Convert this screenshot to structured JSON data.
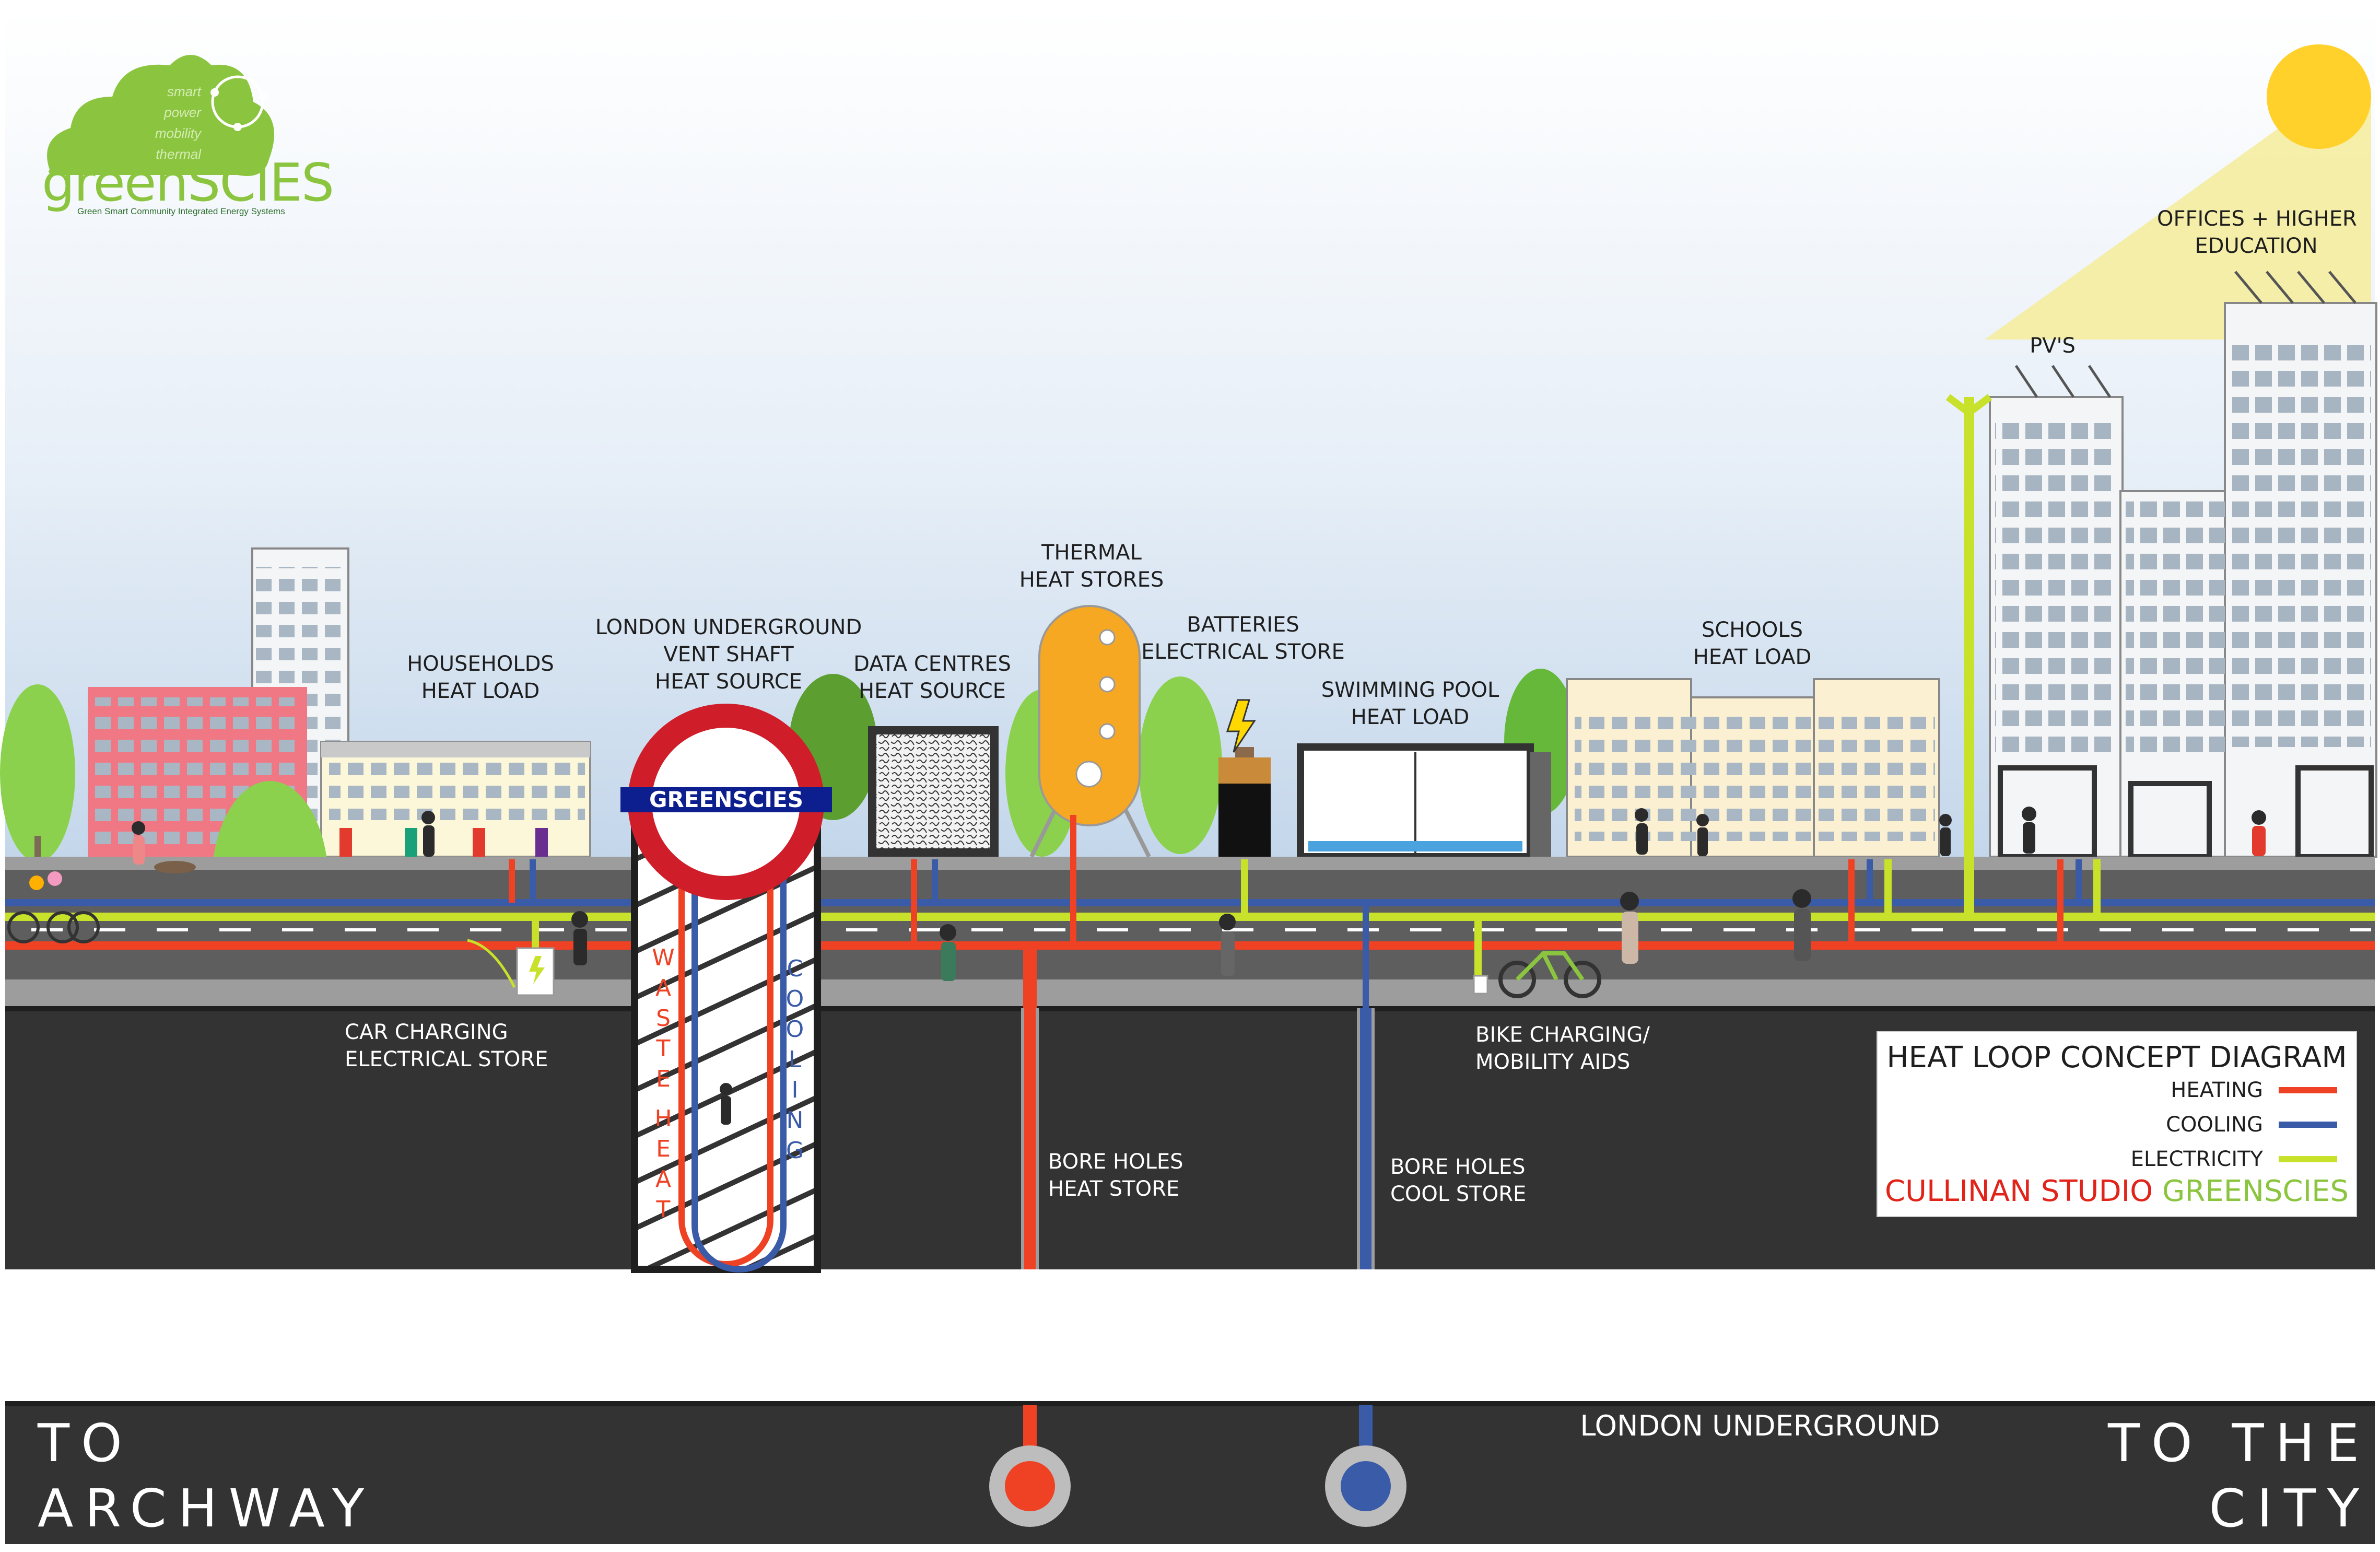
{
  "logo": {
    "name_green": "green",
    "name_caps": "SCIES",
    "tagline": "Green Smart Community Integrated Energy Systems",
    "cloud_words": [
      "smart",
      "power",
      "mobility",
      "thermal"
    ]
  },
  "labels": {
    "households": [
      "HOUSEHOLDS",
      "HEAT LOAD"
    ],
    "vent_shaft": [
      "LONDON UNDERGROUND",
      "VENT SHAFT",
      "HEAT SOURCE"
    ],
    "data_centres": [
      "DATA CENTRES",
      "HEAT SOURCE"
    ],
    "thermal": [
      "THERMAL",
      "HEAT STORES"
    ],
    "batteries": [
      "BATTERIES",
      "ELECTRICAL STORE"
    ],
    "pool": [
      "SWIMMING POOL",
      "HEAT LOAD"
    ],
    "schools": [
      "SCHOOLS",
      "HEAT LOAD"
    ],
    "offices": [
      "OFFICES + HIGHER",
      "EDUCATION"
    ],
    "pvs": "PV'S",
    "car_charging": [
      "CAR CHARGING",
      "ELECTRICAL STORE"
    ],
    "bike_charging": [
      "BIKE CHARGING/",
      "MOBILITY AIDS"
    ],
    "bore_heat": [
      "BORE HOLES",
      "HEAT STORE"
    ],
    "bore_cool": [
      "BORE HOLES",
      "COOL STORE"
    ],
    "underground": "LONDON UNDERGROUND",
    "to_archway": [
      "TO",
      "ARCHWAY"
    ],
    "to_city": [
      "TO THE",
      "CITY"
    ],
    "roundel": "GREENSCIES",
    "waste_heat": [
      "W",
      "A",
      "S",
      "T",
      "E",
      "H",
      "E",
      "A",
      "T"
    ],
    "cooling": [
      "C",
      "O",
      "O",
      "L",
      "I",
      "N",
      "G"
    ]
  },
  "legend": {
    "title": "HEAT LOOP CONCEPT DIAGRAM",
    "items": [
      {
        "label": "HEATING",
        "color": "#ef4123"
      },
      {
        "label": "COOLING",
        "color": "#3a5ba8"
      },
      {
        "label": "ELECTRICITY",
        "color": "#c8e12a"
      }
    ],
    "credit_red": "CULLINAN STUDIO",
    "credit_green": "GREENSCIES",
    "credit_red_color": "#e2231a",
    "credit_green_color": "#8bc53f"
  },
  "colors": {
    "heating": "#ef4123",
    "cooling": "#3a5ba8",
    "electricity": "#c8e12a",
    "ground": "#333333",
    "sun": "#ffd12a",
    "tree": "#8bd14d"
  }
}
